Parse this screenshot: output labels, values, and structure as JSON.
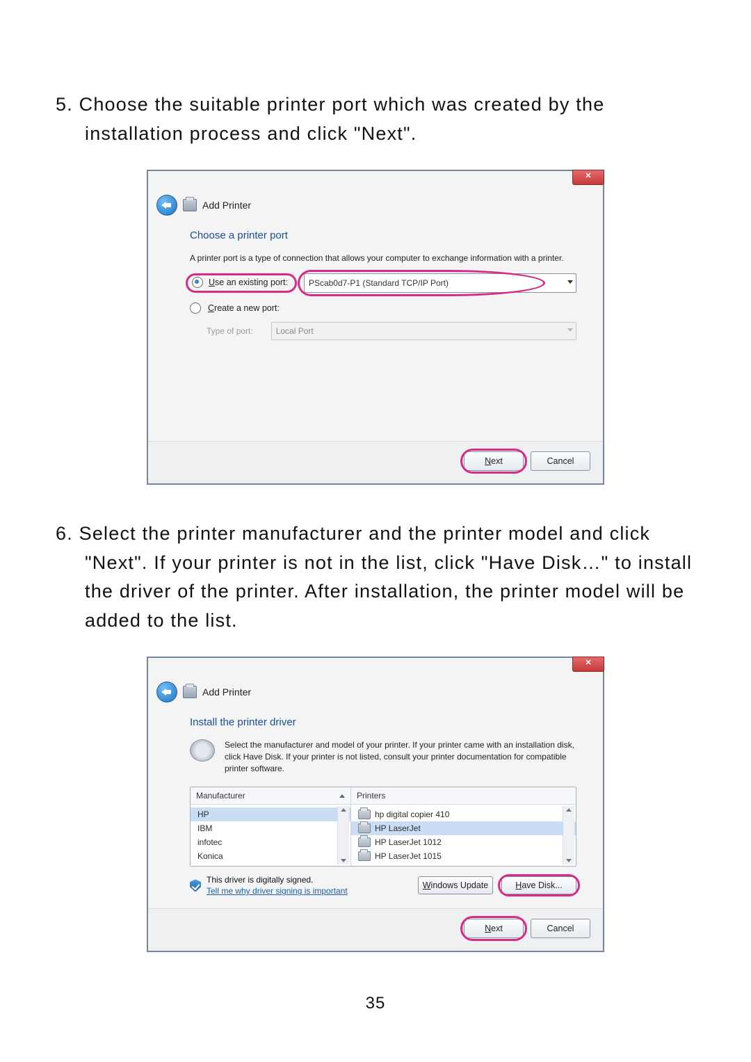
{
  "page_number": "35",
  "steps": {
    "s5": {
      "num": "5. ",
      "text": "Choose the suitable printer port which was created by the installation process and click \"Next\"."
    },
    "s6": {
      "num": "6. ",
      "text": "Select the printer manufacturer and the printer model and click \"Next\". If your printer is not in the list, click \"Have Disk…\" to install the driver of the printer. After installation, the printer model will be added to the list."
    }
  },
  "dialog1": {
    "title": "Add Printer",
    "heading": "Choose a printer port",
    "desc": "A printer port is a type of connection that allows your computer to exchange information with a printer.",
    "use_existing_lbl_prefix": "U",
    "use_existing_lbl_rest": "se an existing port:",
    "existing_port_value": "PScab0d7-P1 (Standard TCP/IP Port)",
    "create_new_lbl_prefix": "C",
    "create_new_lbl_rest": "reate a new port:",
    "type_of_port_lbl": "Type of port:",
    "type_of_port_value": "Local Port",
    "next_lbl": "Next",
    "next_ul": "N",
    "cancel_lbl": "Cancel"
  },
  "dialog2": {
    "title": "Add Printer",
    "heading": "Install the printer driver",
    "desc": "Select the manufacturer and model of your printer. If your printer came with an installation disk, click Have Disk. If your printer is not listed, consult your printer documentation for compatible printer software.",
    "col_mfr": "Manufacturer",
    "col_printers": "Printers",
    "mfrs": [
      "HP",
      "IBM",
      "infotec",
      "Konica"
    ],
    "printers": [
      "hp digital copier 410",
      "HP LaserJet",
      "HP LaserJet 1012",
      "HP LaserJet 1015"
    ],
    "signed_text": "This driver is digitally signed.",
    "why_link": "Tell me why driver signing is important",
    "win_update_lbl": "Windows Update",
    "win_update_ul": "W",
    "have_disk_lbl": "Have Disk...",
    "have_disk_ul": "H",
    "next_lbl": "Next",
    "next_ul": "N",
    "cancel_lbl": "Cancel"
  }
}
